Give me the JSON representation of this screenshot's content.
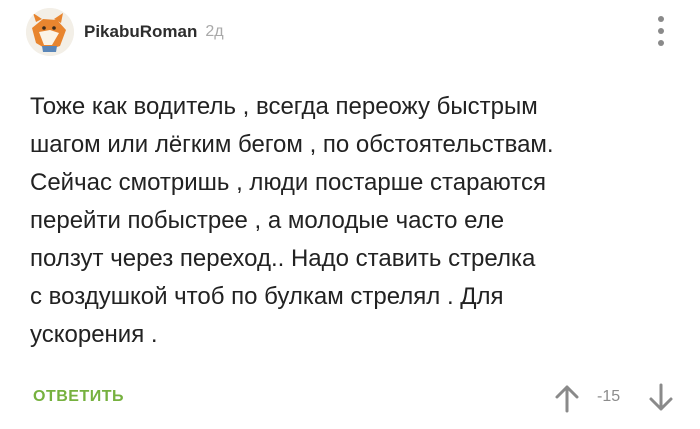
{
  "comment": {
    "author": "PikabuRoman",
    "time": "2д",
    "body_lines": [
      "Тоже как водитель , всегда переожу быстрым",
      "шагом или лёгким бегом , по обстоятельствам.",
      "Сейчас смотришь , люди постарше стараются",
      "перейти побыстрее , а молодые часто еле",
      "ползут через переход.. Надо ставить стрелка",
      "с воздушкой чтоб по булкам стрелял . Для",
      "ускорения ."
    ],
    "reply_label": "ОТВЕТИТЬ",
    "rating": "-15"
  },
  "icons": {
    "more": "more-vertical-icon",
    "upvote": "arrow-up-icon",
    "downvote": "arrow-down-icon"
  },
  "colors": {
    "reply": "#76b13f",
    "text": "#222222",
    "muted": "#a9a9a9",
    "icon": "#8a8a8a"
  }
}
